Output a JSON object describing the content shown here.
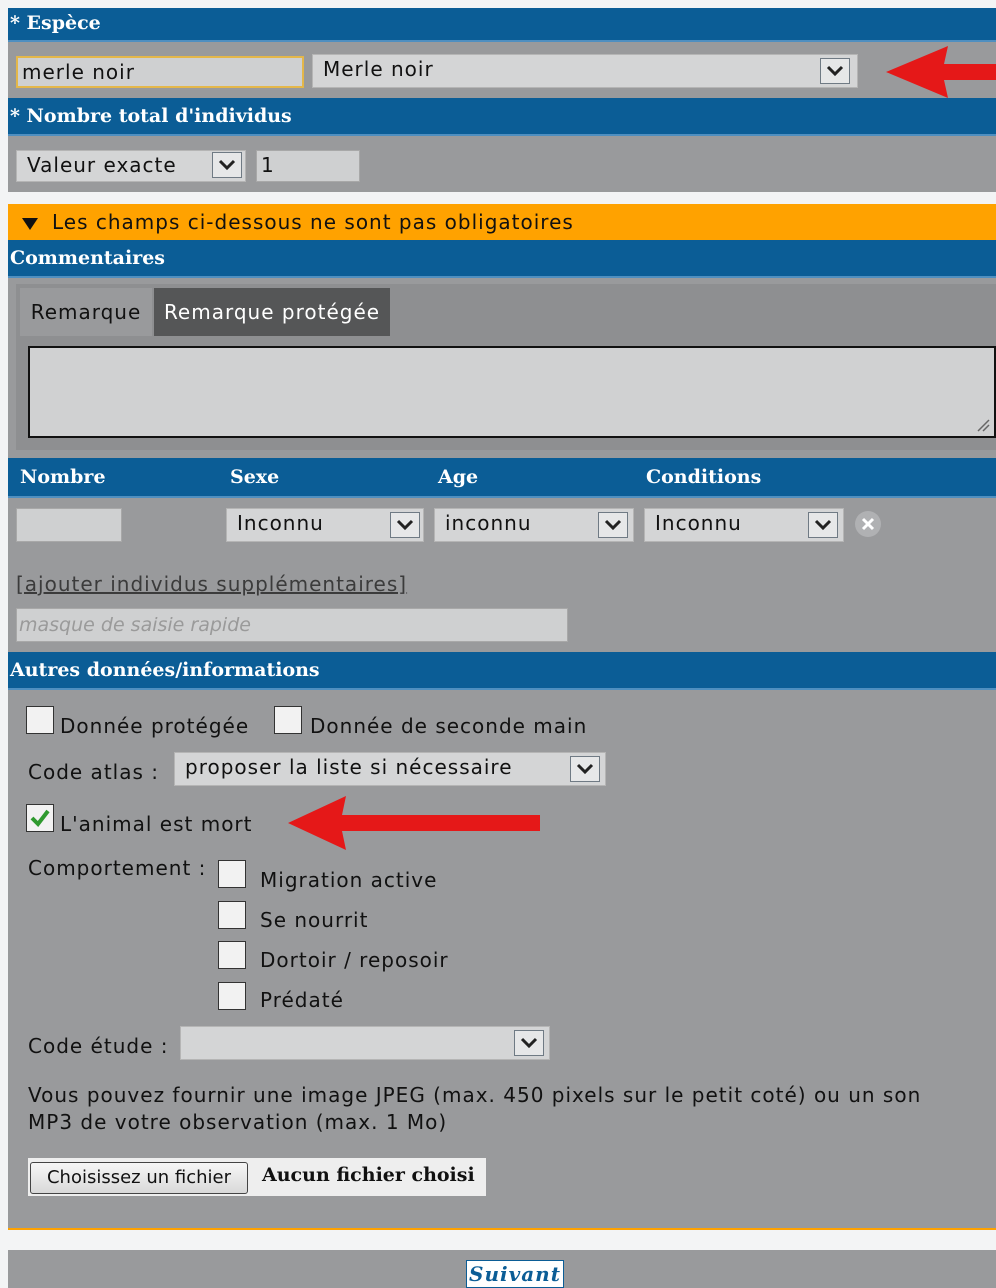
{
  "espece": {
    "header": "* Espèce",
    "input_value": "merle noir",
    "select_value": "Merle noir"
  },
  "nombre_total": {
    "header": "* Nombre total d'individus",
    "mode_value": "Valeur exacte",
    "count_value": "1"
  },
  "optional_banner": "Les champs ci-dessous ne sont pas obligatoires",
  "commentaires": {
    "header": "Commentaires",
    "tabs": [
      "Remarque",
      "Remarque protégée"
    ]
  },
  "individus": {
    "columns": [
      "Nombre",
      "Sexe",
      "Age",
      "Conditions"
    ],
    "row": {
      "nombre": "",
      "sexe": "Inconnu",
      "age": "inconnu",
      "conditions": "Inconnu"
    },
    "add_link": "[ajouter individus supplémentaires]",
    "quick_mask_placeholder": "masque de saisie rapide"
  },
  "autres": {
    "header": "Autres données/informations",
    "donnee_protegee": "Donnée protégée",
    "seconde_main": "Donnée de seconde main",
    "code_atlas_label": "Code atlas :",
    "code_atlas_value": "proposer la liste si nécessaire",
    "animal_mort": "L'animal est mort",
    "comportement_label": "Comportement :",
    "comportements": [
      "Migration active",
      "Se nourrit",
      "Dortoir / reposoir",
      "Prédaté"
    ],
    "code_etude_label": "Code étude :",
    "code_etude_value": "",
    "upload_help": "Vous pouvez fournir une image JPEG (max. 450 pixels sur le petit coté) ou un son MP3 de votre observation (max. 1 Mo)",
    "file_button": "Choisissez un fichier",
    "file_status": "Aucun fichier choisi"
  },
  "footer": {
    "next_button": "Suivant"
  },
  "colors": {
    "header_blue": "#0b5d96",
    "banner_orange": "#ffa200",
    "panel_gray": "#999a9c",
    "arrow_red": "#e51818",
    "check_green": "#2f9a2f"
  }
}
